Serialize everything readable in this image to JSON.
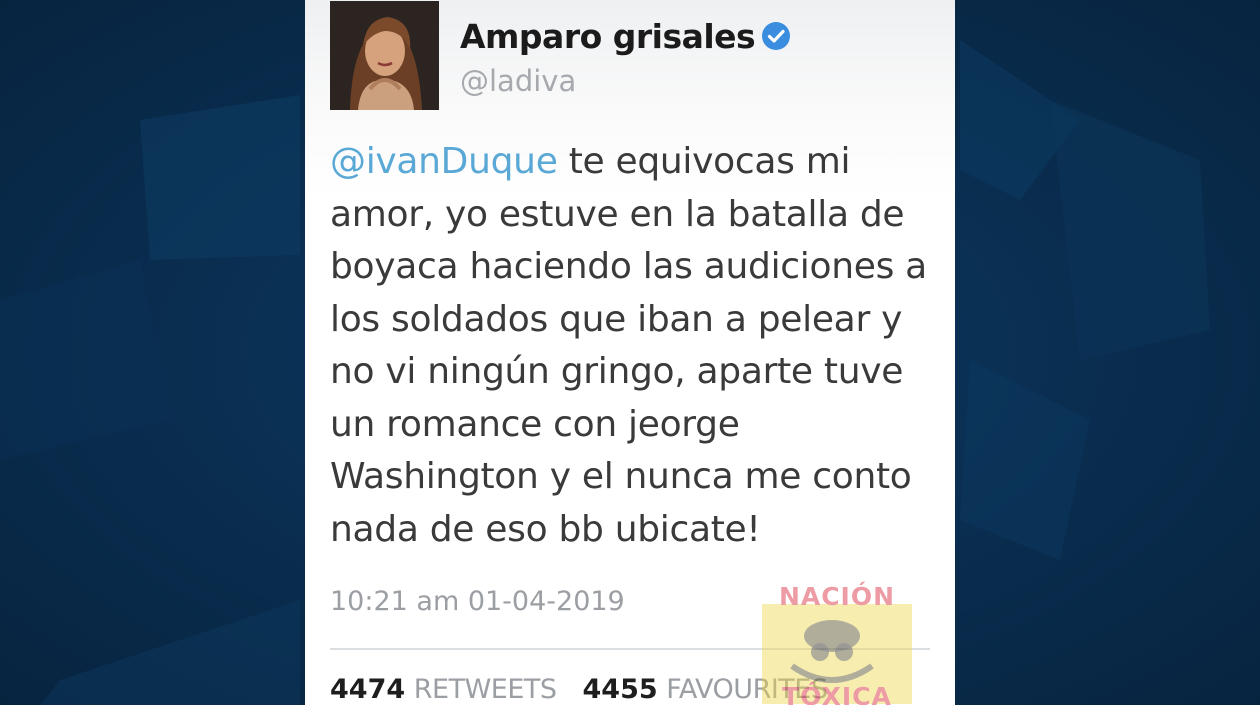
{
  "user": {
    "display_name": "Amparo grisales",
    "handle": "@ladiva",
    "verified": true
  },
  "tweet": {
    "mention": "@ivanDuque",
    "body": " te equivocas mi amor, yo estuve en la batalla de boyaca haciendo las audiciones a los soldados que iban a pelear y no vi ningún gringo, aparte tuve un romance con jeorge Washington y el nunca me conto nada de eso bb ubicate!",
    "timestamp": "10:21 am 01-04-2019"
  },
  "stats": {
    "retweets_count": "4474",
    "retweets_label": "RETWEETS",
    "favourites_count": "4455",
    "favourites_label": "FAVOURITES"
  },
  "watermark": {
    "line1": "NACIÓN",
    "line2": "TÓXICA"
  },
  "colors": {
    "mention": "#5aa8d6",
    "verified": "#3b8de0",
    "background": "#0a2f52"
  },
  "icons": {
    "verified": "verified-badge-icon"
  }
}
